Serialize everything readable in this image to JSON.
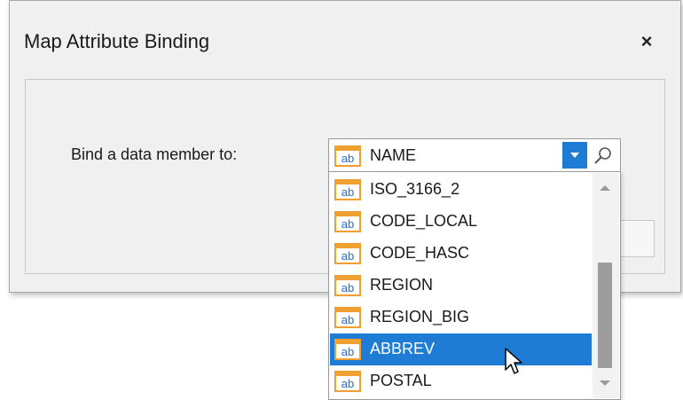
{
  "dialog": {
    "title": "Map Attribute Binding",
    "close_label": "×"
  },
  "form": {
    "bind_label": "Bind a data member to:"
  },
  "combo": {
    "selected_value": "NAME",
    "icon": "ab-field-icon"
  },
  "dropdown": {
    "items": [
      {
        "label": "ISO_3166_2",
        "selected": false
      },
      {
        "label": "CODE_LOCAL",
        "selected": false
      },
      {
        "label": "CODE_HASC",
        "selected": false
      },
      {
        "label": "REGION",
        "selected": false
      },
      {
        "label": "REGION_BIG",
        "selected": false
      },
      {
        "label": "ABBREV",
        "selected": true
      },
      {
        "label": "POSTAL",
        "selected": false
      }
    ],
    "icon_text": "ab"
  },
  "colors": {
    "accent": "#1e7cd4",
    "icon_orange": "#f0a030",
    "icon_blue": "#2a6fc4"
  }
}
